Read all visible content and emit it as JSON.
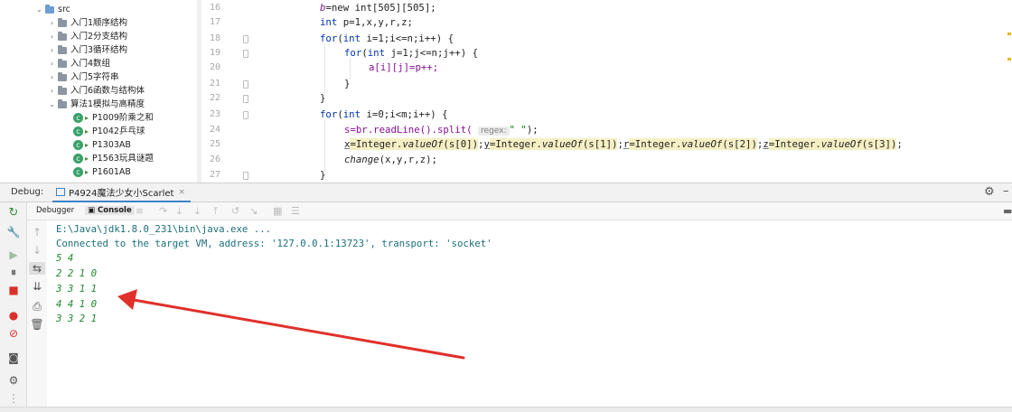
{
  "tree": {
    "items": [
      {
        "label": "src",
        "kind": "src",
        "expanded": true
      },
      {
        "label": "入门1顺序结构",
        "kind": "package",
        "expanded": false
      },
      {
        "label": "入门2分支结构",
        "kind": "package",
        "expanded": false
      },
      {
        "label": "入门3循环结构",
        "kind": "package",
        "expanded": false
      },
      {
        "label": "入门4数组",
        "kind": "package",
        "expanded": false
      },
      {
        "label": "入门5字符串",
        "kind": "package",
        "expanded": false
      },
      {
        "label": "入门6函数与结构体",
        "kind": "package",
        "expanded": false
      },
      {
        "label": "算法1模拟与高精度",
        "kind": "package",
        "expanded": true
      },
      {
        "label": "P1009阶乘之和",
        "kind": "class"
      },
      {
        "label": "P1042乒乓球",
        "kind": "class"
      },
      {
        "label": "P1303AB",
        "kind": "class"
      },
      {
        "label": "P1563玩具谜题",
        "kind": "class"
      },
      {
        "label": "P1601AB",
        "kind": "class"
      }
    ]
  },
  "editor": {
    "line_numbers": [
      "16",
      "17",
      "18",
      "19",
      "20",
      "21",
      "22",
      "23",
      "24",
      "25",
      "26",
      "27"
    ],
    "code": {
      "l16_var": "b",
      "l16_rest": "=new int[505][505];",
      "l17_kw": "int",
      "l17_rest": " p=1,x,y,r,z;",
      "l18_kw": "for",
      "l18_open": "(",
      "l18_kw2": "int",
      "l18_rest": " i=1;i<=n;i++) {",
      "l19_kw": "for",
      "l19_open": "(",
      "l19_kw2": "int",
      "l19_rest": " j=1;j<=n;j++) {",
      "l20": "a[i][j]=p++;",
      "l21": "}",
      "l22": "}",
      "l23_kw": "for",
      "l23_open": "(",
      "l23_kw2": "int",
      "l23_rest": " i=0;i<m;i++) {",
      "l24_a": "s=br.readLine().split(",
      "l24_hint": "regex:",
      "l24_str": "\" \"",
      "l24_b": ");",
      "l25_x": "x",
      "l25_ia": "=Integer.",
      "l25_m": "valueOf",
      "l25_s0": "(s[0])",
      "l25_semi": ";",
      "l25_y": "y",
      "l25_ib": "=Integer.",
      "l25_m2": "valueOf",
      "l25_s1": "(s[1])",
      "l25_semi2": ";",
      "l25_r": "r",
      "l25_ic": "=Integer.",
      "l25_m3": "valueOf",
      "l25_s2": "(s[2])",
      "l25_semi3": ";",
      "l25_z": "z",
      "l25_id": "=Integer.",
      "l25_m4": "valueOf",
      "l25_s3": "(s[3])",
      "l25_end": ";",
      "l26_call": "change",
      "l26_args": "(x,y,r,z);",
      "l27": "}"
    }
  },
  "debug": {
    "title": "Debug:",
    "session_tab": "P4924魔法少女小Scarlet",
    "close": "×",
    "subtabs": {
      "debugger": "Debugger",
      "console": "Console"
    }
  },
  "console": {
    "lines": [
      {
        "text": "E:\\Java\\jdk1.8.0_231\\bin\\java.exe ...",
        "kind": "system"
      },
      {
        "text": "Connected to the target VM, address: '127.0.0.1:13723', transport: 'socket'",
        "kind": "system"
      },
      {
        "text": "5 4",
        "kind": "input"
      },
      {
        "text": "2 2 1 0",
        "kind": "input"
      },
      {
        "text": "3 3 1 1",
        "kind": "input"
      },
      {
        "text": "4 4 1 0",
        "kind": "input"
      },
      {
        "text": "3 3 2 1",
        "kind": "input"
      }
    ]
  },
  "colors": {
    "keyword": "#0033b3",
    "variable": "#871094",
    "console_system": "#1a6f78",
    "console_input": "#1e8a2e",
    "arrow": "#e0302a",
    "selected_tab": "#4083c9"
  },
  "icons": [
    "rerun-icon",
    "wrench-icon",
    "resume-icon",
    "pause-icon",
    "stop-icon",
    "view-breakpoints-icon",
    "mute-breakpoints-icon",
    "camera-icon",
    "settings-icon",
    "pin-icon",
    "up-arrow-icon",
    "down-arrow-icon",
    "soft-wrap-icon",
    "scroll-to-end-icon",
    "print-icon",
    "trash-icon",
    "gear-icon",
    "minimize-icon"
  ]
}
